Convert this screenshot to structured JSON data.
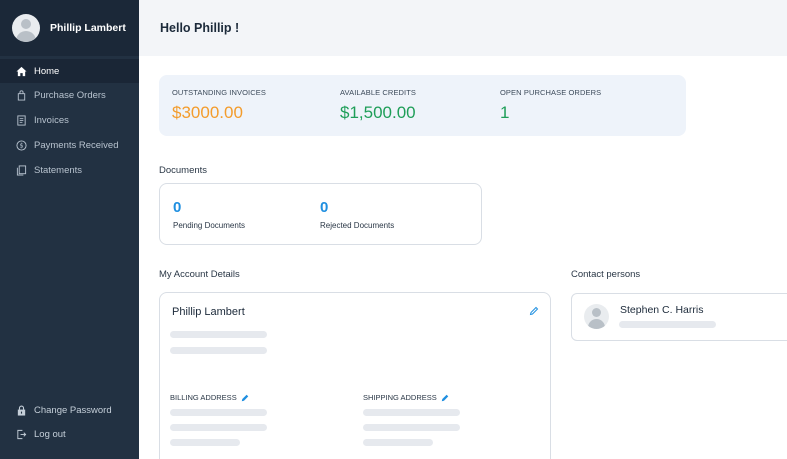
{
  "profile": {
    "name": "Phillip Lambert"
  },
  "nav": {
    "items": [
      {
        "label": "Home",
        "icon": "home-icon"
      },
      {
        "label": "Purchase Orders",
        "icon": "purchase-orders-icon"
      },
      {
        "label": "Invoices",
        "icon": "invoices-icon"
      },
      {
        "label": "Payments Received",
        "icon": "payments-icon"
      },
      {
        "label": "Statements",
        "icon": "statements-icon"
      }
    ],
    "bottom": [
      {
        "label": "Change Password",
        "icon": "lock-icon"
      },
      {
        "label": "Log out",
        "icon": "logout-icon"
      }
    ]
  },
  "header": {
    "greeting": "Hello Phillip !"
  },
  "summary": {
    "outstanding_label": "OUTSTANDING INVOICES",
    "outstanding_value": "$3000.00",
    "credits_label": "AVAILABLE CREDITS",
    "credits_value": "$1,500.00",
    "open_po_label": "OPEN PURCHASE ORDERS",
    "open_po_value": "1"
  },
  "documents": {
    "title": "Documents",
    "pending_count": "0",
    "pending_label": "Pending Documents",
    "rejected_count": "0",
    "rejected_label": "Rejected Documents"
  },
  "account": {
    "title": "My Account Details",
    "name": "Phillip Lambert",
    "billing_label": "BILLING ADDRESS",
    "shipping_label": "SHIPPING ADDRESS"
  },
  "contacts": {
    "title": "Contact persons",
    "name": "Stephen C. Harris"
  },
  "colors": {
    "sidebar": "#223142",
    "outstanding": "#f39c2c",
    "credits": "#1e9e58",
    "open_po": "#1e9e58",
    "doc_count": "#1f8fe0",
    "pencil": "#1f8fe0"
  }
}
